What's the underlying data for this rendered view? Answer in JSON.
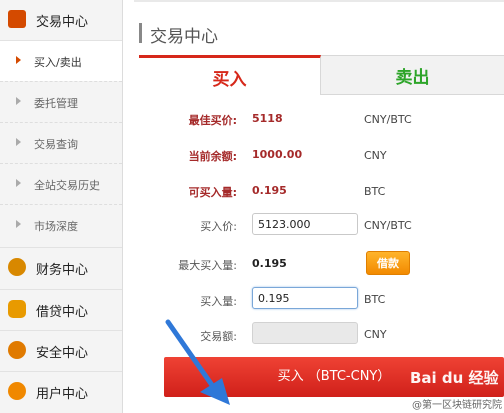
{
  "sidebar": {
    "sections": [
      {
        "label": "交易中心",
        "color": "#d44a00"
      },
      {
        "label": "财务中心",
        "color": "#d88800"
      },
      {
        "label": "借贷中心",
        "color": "#e89a00"
      },
      {
        "label": "安全中心",
        "color": "#e07a00"
      },
      {
        "label": "用户中心",
        "color": "#f08800"
      }
    ],
    "sub_items": [
      {
        "label": "买入/卖出",
        "active": true
      },
      {
        "label": "委托管理",
        "active": false
      },
      {
        "label": "交易查询",
        "active": false
      },
      {
        "label": "全站交易历史",
        "active": false
      },
      {
        "label": "市场深度",
        "active": false
      }
    ]
  },
  "panel": {
    "title": "交易中心"
  },
  "tabs": {
    "buy": "买入",
    "sell": "卖出"
  },
  "form": {
    "best_bid_label": "最佳买价:",
    "best_bid_value": "5118",
    "best_bid_unit": "CNY/BTC",
    "balance_label": "当前余额:",
    "balance_value": "1000.00",
    "balance_unit": "CNY",
    "buyable_label": "可买入量:",
    "buyable_value": "0.195",
    "buyable_unit": "BTC",
    "price_label": "买入价:",
    "price_value": "5123.000",
    "price_unit": "CNY/BTC",
    "max_label": "最大买入量:",
    "max_value": "0.195",
    "loan_button": "借款",
    "amount_label": "买入量:",
    "amount_value": "0.195",
    "amount_unit": "BTC",
    "total_label": "交易额:",
    "total_value": "",
    "total_unit": "CNY"
  },
  "submit_button": "买入 （BTC-CNY）",
  "watermark": {
    "text": "Bai du 经验",
    "sub": "@第一区块链研究院"
  },
  "colors": {
    "accent_red": "#d6281a",
    "sell_green": "#2ea52a",
    "label_red": "#a52a2a",
    "loan_orange": "#f28a00",
    "arrow_blue": "#2f78d8"
  }
}
